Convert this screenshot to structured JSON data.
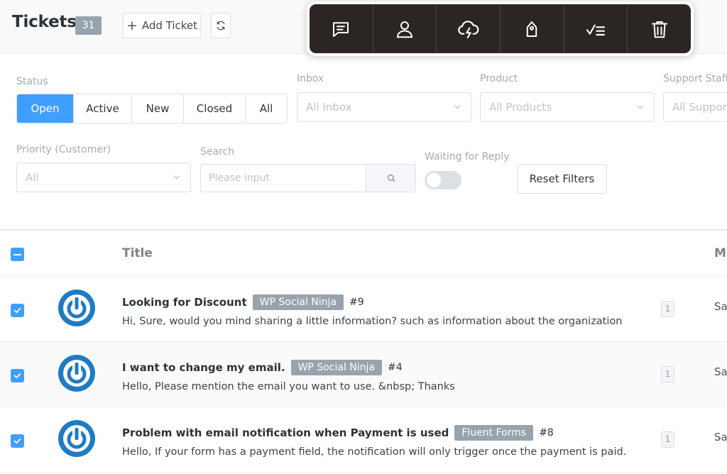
{
  "header": {
    "title": "Tickets",
    "count": "31",
    "add_ticket_label": "Add Ticket"
  },
  "bulk_actions": [
    {
      "icon": "chat-icon"
    },
    {
      "icon": "user-icon"
    },
    {
      "icon": "cloud-bolt-icon"
    },
    {
      "icon": "tag-icon"
    },
    {
      "icon": "checklist-icon"
    },
    {
      "icon": "trash-icon"
    }
  ],
  "filters": {
    "status_label": "Status",
    "status_options": [
      "Open",
      "Active",
      "New",
      "Closed",
      "All"
    ],
    "status_selected": "Open",
    "inbox_label": "Inbox",
    "inbox_value": "All Inbox",
    "product_label": "Product",
    "product_value": "All Products",
    "staff_label": "Support Staff",
    "staff_value": "All Support Staff",
    "priority_label": "Priority (Customer)",
    "priority_value": "All",
    "search_label": "Search",
    "search_placeholder": "Please input",
    "waiting_label": "Waiting for Reply",
    "waiting_on": false,
    "reset_label": "Reset Filters"
  },
  "table": {
    "col_title": "Title",
    "col_next": "M",
    "rows": [
      {
        "title": "Looking for Discount",
        "product": "WP Social Ninja",
        "number": "#9",
        "excerpt": "Hi, Sure, would you mind sharing a little information? such as information about the organization",
        "replies": "1",
        "next_col": "Sa"
      },
      {
        "title": "I want to change my email.",
        "product": "WP Social Ninja",
        "number": "#4",
        "excerpt": "Hello, Please mention the email you want to use. &nbsp; Thanks",
        "replies": "1",
        "next_col": "Sa"
      },
      {
        "title": "Problem with email notification when Payment is used",
        "product": "Fluent Forms",
        "number": "#8",
        "excerpt": "Hello, If your form has a payment field, the notification will only trigger once the payment is paid.",
        "replies": "1",
        "next_col": "Sa"
      }
    ]
  },
  "colors": {
    "accent": "#409eff",
    "tag": "#98a3ad",
    "toolbar": "#2b2523",
    "avatar": "#1e7bc4"
  }
}
